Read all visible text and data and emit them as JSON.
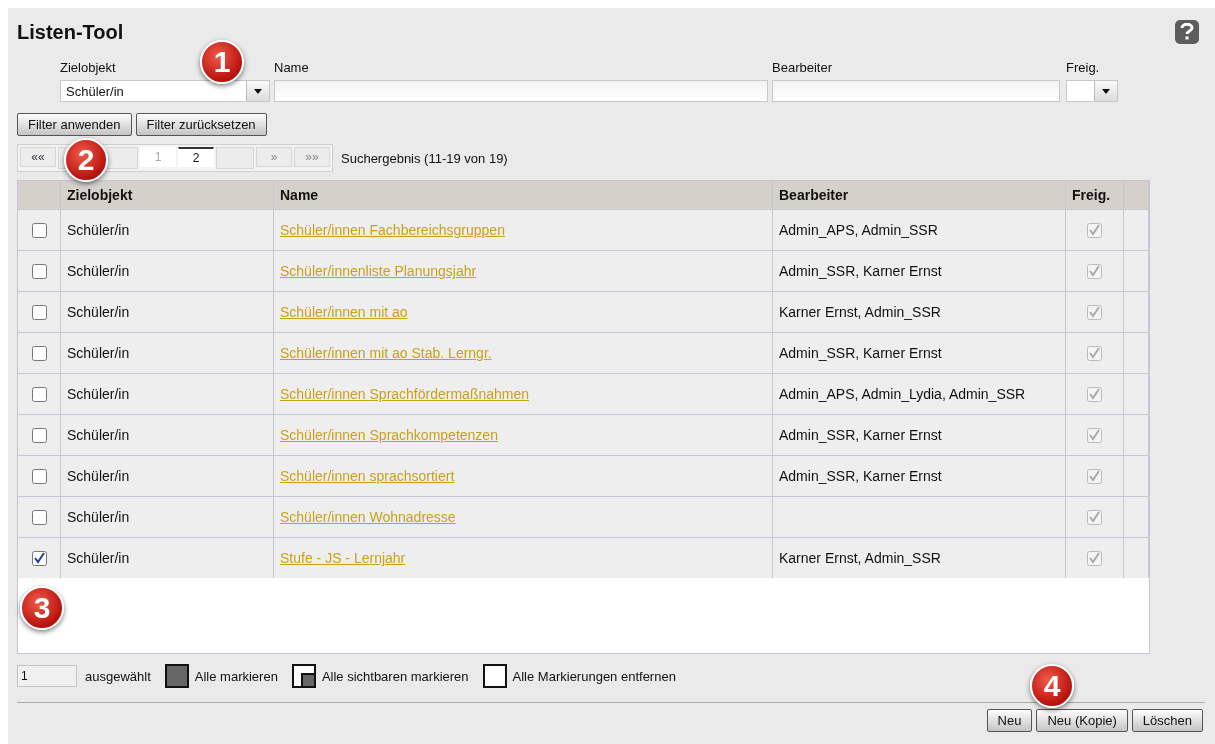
{
  "title": "Listen-Tool",
  "filters": {
    "zielobjekt": {
      "label": "Zielobjekt",
      "value": "Schüler/in"
    },
    "name": {
      "label": "Name"
    },
    "bearbeiter": {
      "label": "Bearbeiter"
    },
    "freig": {
      "label": "Freig."
    }
  },
  "filter_buttons": [
    "Filter anwenden",
    "Filter zurücksetzen"
  ],
  "pager": [
    {
      "kind": "nav",
      "label": "««",
      "disabled": false
    },
    {
      "kind": "blank"
    },
    {
      "kind": "blank"
    },
    {
      "kind": "page",
      "label": "1",
      "selected": false
    },
    {
      "kind": "page",
      "label": "2",
      "selected": true
    },
    {
      "kind": "blank"
    },
    {
      "kind": "nav",
      "label": "»",
      "disabled": true
    },
    {
      "kind": "nav",
      "label": "»»",
      "disabled": true
    }
  ],
  "result_text": "Suchergebnis (11-19 von 19)",
  "table": {
    "columns": [
      "Zielobjekt",
      "Name",
      "Bearbeiter",
      "Freig."
    ],
    "rows": [
      {
        "checked": false,
        "zielobjekt": "Schüler/in",
        "name": "Schüler/innen Fachbereichsgruppen",
        "bearbeiter": "Admin_APS, Admin_SSR",
        "freig": true
      },
      {
        "checked": false,
        "zielobjekt": "Schüler/in",
        "name": "Schüler/innenliste Planungsjahr",
        "bearbeiter": "Admin_SSR, Karner Ernst",
        "freig": true
      },
      {
        "checked": false,
        "zielobjekt": "Schüler/in",
        "name": "Schüler/innen mit ao",
        "bearbeiter": "Karner Ernst, Admin_SSR",
        "freig": true
      },
      {
        "checked": false,
        "zielobjekt": "Schüler/in",
        "name": "Schüler/innen mit ao Stab. Lerngr.",
        "bearbeiter": "Admin_SSR, Karner Ernst",
        "freig": true
      },
      {
        "checked": false,
        "zielobjekt": "Schüler/in",
        "name": "Schüler/innen Sprachfördermaßnahmen",
        "bearbeiter": "Admin_APS, Admin_Lydia, Admin_SSR",
        "freig": true
      },
      {
        "checked": false,
        "zielobjekt": "Schüler/in",
        "name": "Schüler/innen Sprachkompetenzen",
        "bearbeiter": "Admin_SSR, Karner Ernst",
        "freig": true
      },
      {
        "checked": false,
        "zielobjekt": "Schüler/in",
        "name": "Schüler/innen sprachsortiert",
        "bearbeiter": "Admin_SSR, Karner Ernst",
        "freig": true
      },
      {
        "checked": false,
        "zielobjekt": "Schüler/in",
        "name": "Schüler/innen Wohnadresse",
        "freig": true
      },
      {
        "checked": true,
        "zielobjekt": "Schüler/in",
        "name": "Stufe - JS - Lernjahr",
        "bearbeiter": "Karner Ernst, Admin_SSR",
        "freig": true
      }
    ]
  },
  "selection": {
    "count": "1",
    "label": "ausgewählt",
    "actions": [
      {
        "kind": "all",
        "label": "Alle markieren"
      },
      {
        "kind": "visible",
        "label": "Alle sichtbaren markieren"
      },
      {
        "kind": "none",
        "label": "Alle Markierungen entfernen"
      }
    ]
  },
  "buttons": [
    "Neu",
    "Neu (Kopie)",
    "Löschen"
  ],
  "callouts": [
    "1",
    "2",
    "3",
    "4"
  ]
}
